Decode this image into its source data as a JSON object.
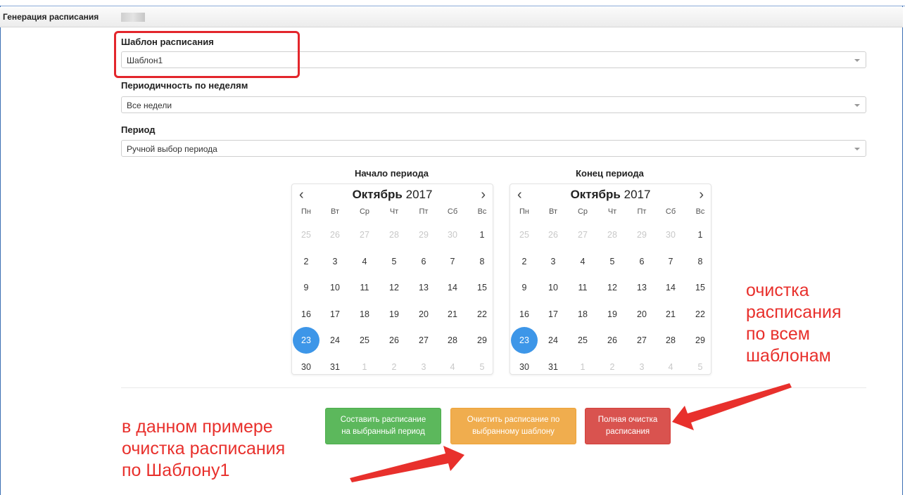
{
  "window": {
    "title": "Генерация расписания"
  },
  "form": {
    "template_label": "Шаблон расписания",
    "template_value": "Шаблон1",
    "weeks_label": "Периодичность по неделям",
    "weeks_value": "Все недели",
    "period_label": "Период",
    "period_value": "Ручной выбор периода"
  },
  "calendars": [
    {
      "title": "Начало периода",
      "month": "Октябрь",
      "year": "2017",
      "weekdays": [
        "Пн",
        "Вт",
        "Ср",
        "Чт",
        "Пт",
        "Сб",
        "Вс"
      ],
      "weeks": [
        [
          "25",
          "26",
          "27",
          "28",
          "29",
          "30",
          "1"
        ],
        [
          "2",
          "3",
          "4",
          "5",
          "6",
          "7",
          "8"
        ],
        [
          "9",
          "10",
          "11",
          "12",
          "13",
          "14",
          "15"
        ],
        [
          "16",
          "17",
          "18",
          "19",
          "20",
          "21",
          "22"
        ],
        [
          "23",
          "24",
          "25",
          "26",
          "27",
          "28",
          "29"
        ],
        [
          "30",
          "31",
          "1",
          "2",
          "3",
          "4",
          "5"
        ]
      ],
      "selected": "23"
    },
    {
      "title": "Конец периода",
      "month": "Октябрь",
      "year": "2017",
      "weekdays": [
        "Пн",
        "Вт",
        "Ср",
        "Чт",
        "Пт",
        "Сб",
        "Вс"
      ],
      "weeks": [
        [
          "25",
          "26",
          "27",
          "28",
          "29",
          "30",
          "1"
        ],
        [
          "2",
          "3",
          "4",
          "5",
          "6",
          "7",
          "8"
        ],
        [
          "9",
          "10",
          "11",
          "12",
          "13",
          "14",
          "15"
        ],
        [
          "16",
          "17",
          "18",
          "19",
          "20",
          "21",
          "22"
        ],
        [
          "23",
          "24",
          "25",
          "26",
          "27",
          "28",
          "29"
        ],
        [
          "30",
          "31",
          "1",
          "2",
          "3",
          "4",
          "5"
        ]
      ],
      "selected": "23"
    }
  ],
  "buttons": {
    "generate_line1": "Составить расписание",
    "generate_line2": "на выбранный период",
    "clear_template_line1": "Очистить расписание по",
    "clear_template_line2": "выбранному шаблону",
    "clear_all_line1": "Полная очистка",
    "clear_all_line2": "расписания"
  },
  "annotations": {
    "right": [
      "очистка",
      "расписания",
      "по всем",
      "шаблонам"
    ],
    "left": [
      "в данном примере",
      "очистка расписания",
      "по Шаблону1"
    ]
  },
  "colors": {
    "selected_day": "#3d96e8",
    "annotation": "#e8302c",
    "btn_green": "#5cb85c",
    "btn_orange": "#f0ad4e",
    "btn_red": "#d9534f"
  }
}
